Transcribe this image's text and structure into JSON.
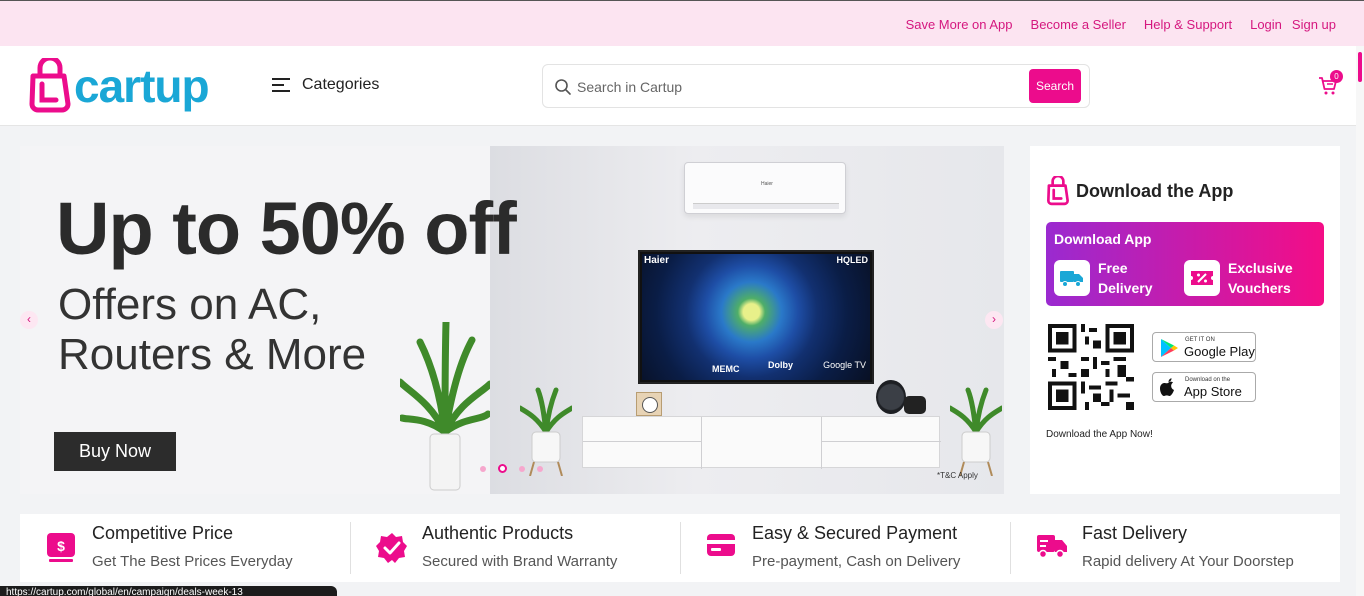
{
  "topbar": {
    "links": [
      "Save More on App",
      "Become a Seller",
      "Help & Support",
      "Login",
      "Sign up"
    ]
  },
  "header": {
    "logo_text": "cartup",
    "categories_label": "Categories",
    "search_placeholder": "Search in Cartup",
    "search_button": "Search",
    "cart_count": "0"
  },
  "hero": {
    "headline": "Up to 50% off",
    "subheadline": "Offers on AC, Routers & More",
    "cta": "Buy Now",
    "disclaimer": "*T&C Apply",
    "tv_brand": "Haier",
    "tv_model": "HQLED",
    "tv_features": [
      "MEMC",
      "Dolby",
      "Google TV"
    ],
    "slides_total": 4,
    "slide_active": 2
  },
  "app_panel": {
    "title": "Download the App",
    "promo_title": "Download App",
    "promo_items": [
      "Free Delivery",
      "Exclusive Vouchers"
    ],
    "google_play_small": "GET IT ON",
    "google_play_big": "Google Play",
    "app_store_small": "Download on the",
    "app_store_big": "App Store",
    "note": "Download the App Now!"
  },
  "features": [
    {
      "title": "Competitive Price",
      "subtitle": "Get The Best Prices Everyday",
      "icon": "price-tag-icon"
    },
    {
      "title": "Authentic Products",
      "subtitle": "Secured with Brand Warranty",
      "icon": "verified-badge-icon"
    },
    {
      "title": "Easy & Secured Payment",
      "subtitle": "Pre-payment, Cash on Delivery",
      "icon": "credit-card-icon"
    },
    {
      "title": "Fast Delivery",
      "subtitle": "Rapid delivery At Your Doorstep",
      "icon": "delivery-truck-icon"
    }
  ],
  "colors": {
    "brand_pink": "#ec0c8c",
    "brand_blue": "#1aa7d6",
    "topbar_bg": "#fce4f1"
  },
  "statusbar": {
    "url": "https://cartup.com/global/en/campaign/deals-week-13"
  }
}
